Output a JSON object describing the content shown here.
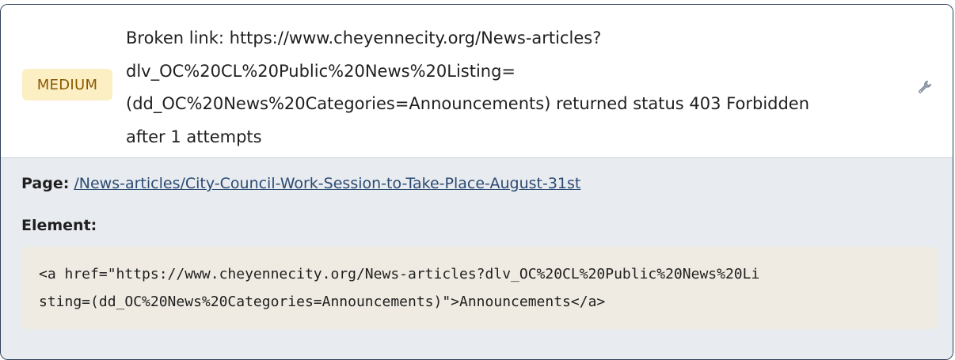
{
  "issue": {
    "severity": "MEDIUM",
    "message_lines": [
      "Broken link: https://www.cheyennecity.org/News-articles?",
      "dlv_OC%20CL%20Public%20News%20Listing=",
      "(dd_OC%20News%20Categories=Announcements) returned status 403 Forbidden",
      "after 1 attempts"
    ],
    "action_icon": "wrench-icon"
  },
  "details": {
    "page_label": "Page:",
    "page_link": "/News-articles/City-Council-Work-Session-to-Take-Place-August-31st",
    "element_label": "Element:",
    "element_code_lines": [
      "<a href=\"https://www.cheyennecity.org/News-articles?dlv_OC%20CL%20Public%20News%20Li",
      "sting=(dd_OC%20News%20Categories=Announcements)\">Announcements</a>"
    ]
  },
  "colors": {
    "border": "#2d3f57",
    "badge_bg": "#fcefc4",
    "badge_text": "#8a5a00",
    "details_bg": "#e8ebef",
    "code_bg": "#efebe2",
    "link": "#2b4a72"
  }
}
